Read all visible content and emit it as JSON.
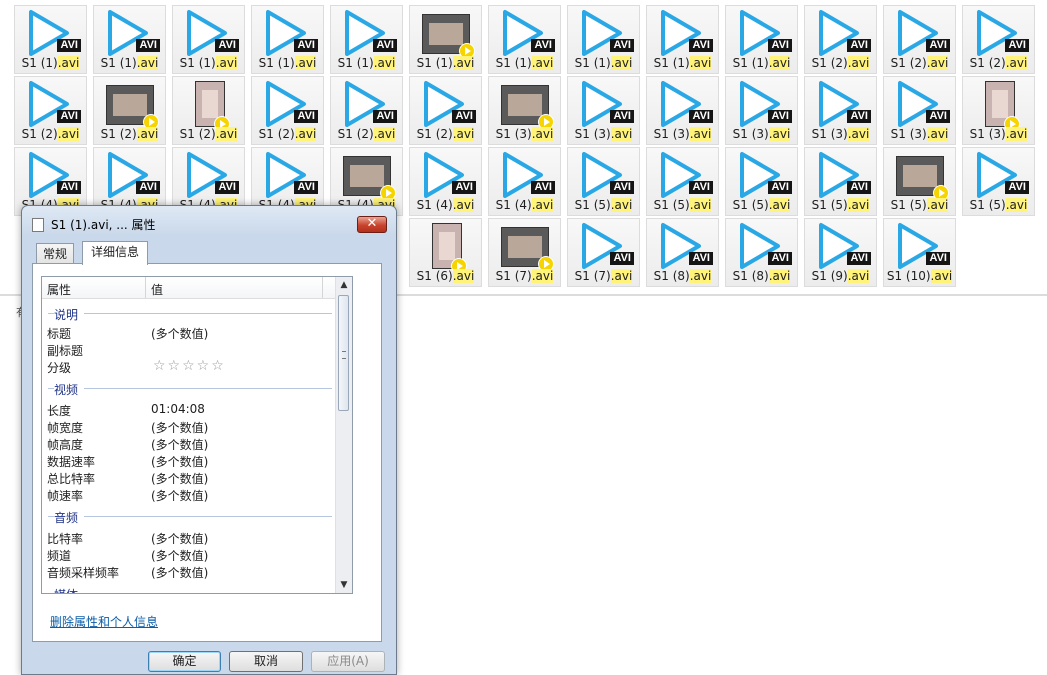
{
  "files": [
    {
      "name": "S1 (1)",
      "ext": ".avi",
      "thumb": "avi"
    },
    {
      "name": "S1 (1)",
      "ext": ".avi",
      "thumb": "avi"
    },
    {
      "name": "S1 (1)",
      "ext": ".avi",
      "thumb": "avi"
    },
    {
      "name": "S1 (1)",
      "ext": ".avi",
      "thumb": "avi"
    },
    {
      "name": "S1 (1)",
      "ext": ".avi",
      "thumb": "avi"
    },
    {
      "name": "S1 (1)",
      "ext": ".avi",
      "thumb": "video"
    },
    {
      "name": "S1 (1)",
      "ext": ".avi",
      "thumb": "avi"
    },
    {
      "name": "S1 (1)",
      "ext": ".avi",
      "thumb": "avi"
    },
    {
      "name": "S1 (1)",
      "ext": ".avi",
      "thumb": "avi"
    },
    {
      "name": "S1 (1)",
      "ext": ".avi",
      "thumb": "avi"
    },
    {
      "name": "S1 (2)",
      "ext": ".avi",
      "thumb": "avi"
    },
    {
      "name": "S1 (2)",
      "ext": ".avi",
      "thumb": "avi"
    },
    {
      "name": "S1 (2)",
      "ext": ".avi",
      "thumb": "avi"
    },
    {
      "name": "S1 (2)",
      "ext": ".avi",
      "thumb": "avi"
    },
    {
      "name": "S1 (2)",
      "ext": ".avi",
      "thumb": "video"
    },
    {
      "name": "S1 (2)",
      "ext": ".avi",
      "thumb": "portrait"
    },
    {
      "name": "S1 (2)",
      "ext": ".avi",
      "thumb": "avi"
    },
    {
      "name": "S1 (2)",
      "ext": ".avi",
      "thumb": "avi"
    },
    {
      "name": "S1 (2)",
      "ext": ".avi",
      "thumb": "avi"
    },
    {
      "name": "S1 (3)",
      "ext": ".avi",
      "thumb": "video"
    },
    {
      "name": "S1 (3)",
      "ext": ".avi",
      "thumb": "avi"
    },
    {
      "name": "S1 (3)",
      "ext": ".avi",
      "thumb": "avi"
    },
    {
      "name": "S1 (3)",
      "ext": ".avi",
      "thumb": "avi"
    },
    {
      "name": "S1 (3)",
      "ext": ".avi",
      "thumb": "avi"
    },
    {
      "name": "S1 (3)",
      "ext": ".avi",
      "thumb": "avi"
    },
    {
      "name": "S1 (3)",
      "ext": ".avi",
      "thumb": "portrait"
    },
    {
      "name": "S1 (4)",
      "ext": ".avi",
      "thumb": "avi"
    },
    {
      "name": "S1 (4)",
      "ext": ".avi",
      "thumb": "avi"
    },
    {
      "name": "S1 (4)",
      "ext": ".avi",
      "thumb": "avi"
    },
    {
      "name": "S1 (4)",
      "ext": ".avi",
      "thumb": "avi"
    },
    {
      "name": "S1 (4)",
      "ext": ".avi",
      "thumb": "video"
    },
    {
      "name": "S1 (4)",
      "ext": ".avi",
      "thumb": "avi"
    },
    {
      "name": "S1 (4)",
      "ext": ".avi",
      "thumb": "avi"
    },
    {
      "name": "S1 (5)",
      "ext": ".avi",
      "thumb": "avi"
    },
    {
      "name": "S1 (5)",
      "ext": ".avi",
      "thumb": "avi"
    },
    {
      "name": "S1 (5)",
      "ext": ".avi",
      "thumb": "avi"
    },
    {
      "name": "S1 (5)",
      "ext": ".avi",
      "thumb": "avi"
    },
    {
      "name": "S1 (5)",
      "ext": ".avi",
      "thumb": "video"
    },
    {
      "name": "S1 (5)",
      "ext": ".avi",
      "thumb": "avi"
    },
    {
      "name": "S1 (6)",
      "ext": ".avi",
      "thumb": "portrait"
    },
    {
      "name": "S1 (7)",
      "ext": ".avi",
      "thumb": "video"
    },
    {
      "name": "S1 (7)",
      "ext": ".avi",
      "thumb": "avi"
    },
    {
      "name": "S1 (8)",
      "ext": ".avi",
      "thumb": "avi"
    },
    {
      "name": "S1 (8)",
      "ext": ".avi",
      "thumb": "avi"
    },
    {
      "name": "S1 (9)",
      "ext": ".avi",
      "thumb": "avi"
    },
    {
      "name": "S1 (10)",
      "ext": ".avi",
      "thumb": "avi"
    }
  ],
  "avi_badge": "AVI",
  "status_char": "有",
  "dialog": {
    "title": "S1 (1).avi, ... 属性",
    "close_glyph": "✕",
    "tabs": [
      {
        "label": "常规"
      },
      {
        "label": "详细信息"
      }
    ],
    "columns": {
      "property": "属性",
      "value": "值"
    },
    "groups": {
      "description": "说明",
      "video": "视频",
      "audio": "音频",
      "media": "媒体"
    },
    "rows": {
      "title": {
        "label": "标题",
        "value": "(多个数值)"
      },
      "subtitle": {
        "label": "副标题",
        "value": ""
      },
      "rating": {
        "label": "分级",
        "stars": "☆☆☆☆☆",
        "stars_filled": 0,
        "stars_max": 5
      },
      "length": {
        "label": "长度",
        "value": "01:04:08"
      },
      "frame_width": {
        "label": "帧宽度",
        "value": "(多个数值)"
      },
      "frame_height": {
        "label": "帧高度",
        "value": "(多个数值)"
      },
      "data_rate": {
        "label": "数据速率",
        "value": "(多个数值)"
      },
      "total_bitrate": {
        "label": "总比特率",
        "value": "(多个数值)"
      },
      "frame_rate": {
        "label": "帧速率",
        "value": "(多个数值)"
      },
      "bitrate": {
        "label": "比特率",
        "value": "(多个数值)"
      },
      "channels": {
        "label": "频道",
        "value": "(多个数值)"
      },
      "sample_rate": {
        "label": "音频采样频率",
        "value": "(多个数值)"
      }
    },
    "scroll": {
      "up": "▲",
      "down": "▼"
    },
    "remove_link": "删除属性和个人信息",
    "buttons": {
      "ok": "确定",
      "cancel": "取消",
      "apply": "应用(A)"
    }
  }
}
